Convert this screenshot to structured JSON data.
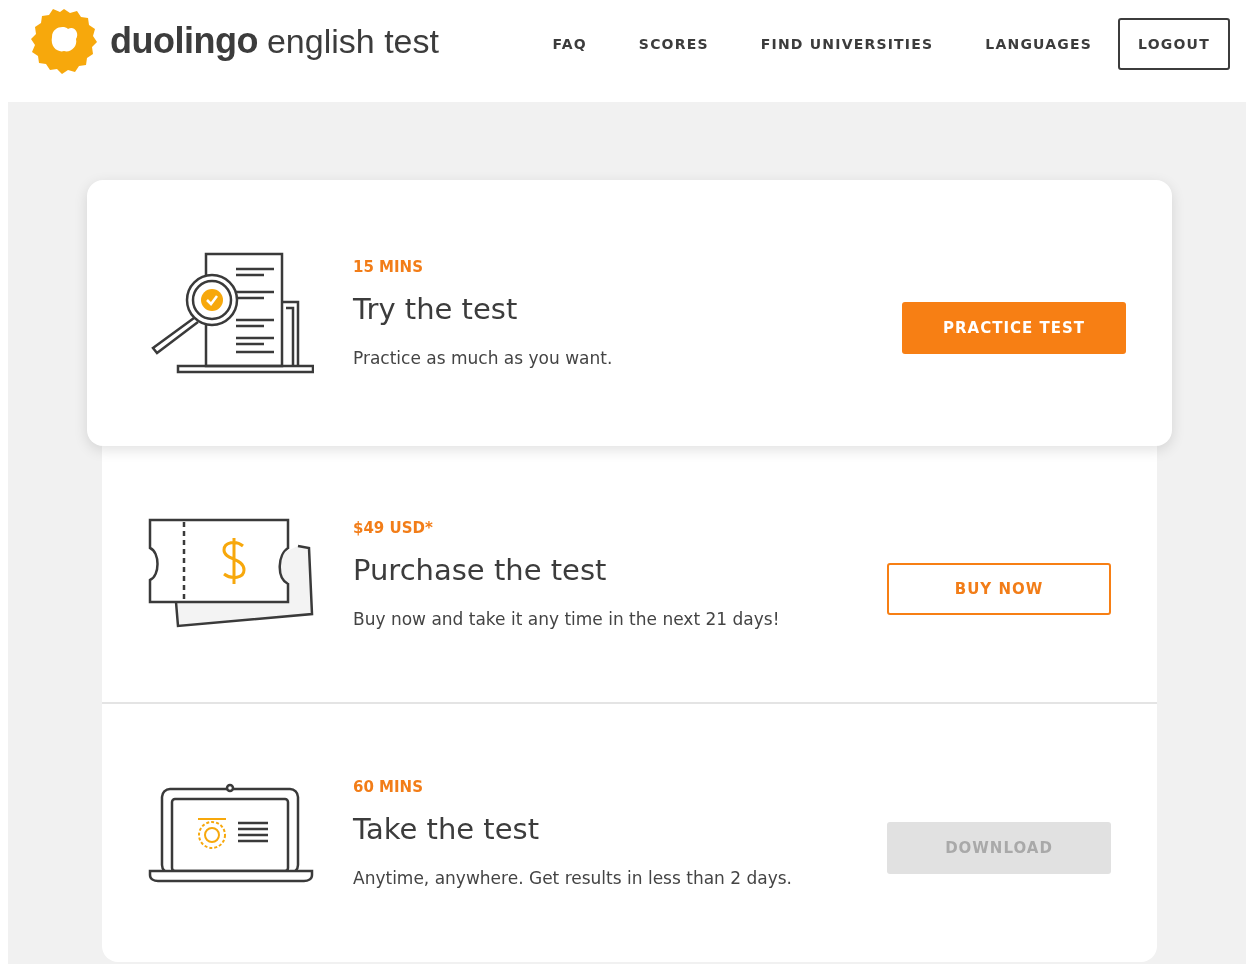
{
  "header": {
    "logo": {
      "brand": "duolingo",
      "product": "english test"
    },
    "nav": [
      {
        "label": "FAQ"
      },
      {
        "label": "SCORES"
      },
      {
        "label": "FIND UNIVERSITIES"
      },
      {
        "label": "LANGUAGES"
      }
    ],
    "logout": "LOGOUT"
  },
  "steps": [
    {
      "kind": "practice",
      "raised": true,
      "tag": "15 MINS",
      "title": "Try the test",
      "description": "Practice as much as you want.",
      "button": {
        "label": "PRACTICE TEST",
        "kind": "filled",
        "disabled": false
      }
    },
    {
      "kind": "purchase",
      "raised": false,
      "tag": "$49 USD*",
      "title": "Purchase the test",
      "description": "Buy now and take it any time in the next 21 days!",
      "button": {
        "label": "BUY NOW",
        "kind": "outline",
        "disabled": false
      }
    },
    {
      "kind": "take",
      "raised": false,
      "tag": "60 MINS",
      "title": "Take the test",
      "description": "Anytime, anywhere. Get results in less than 2 days.",
      "button": {
        "label": "DOWNLOAD",
        "kind": "filled",
        "disabled": true
      }
    }
  ]
}
